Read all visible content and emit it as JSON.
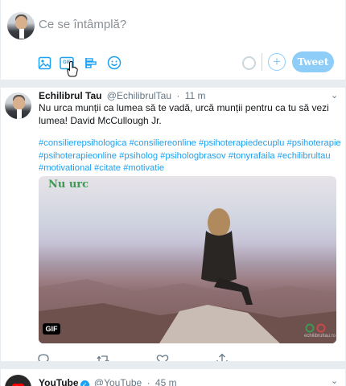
{
  "composer": {
    "placeholder": "Ce se întâmplă?",
    "gif_label": "GIF",
    "tweet_label": "Tweet",
    "add_label": "+",
    "icons": [
      "image-icon",
      "gif-icon",
      "poll-icon",
      "emoji-icon"
    ]
  },
  "tweet1": {
    "name": "Echilibrul Tau",
    "handle": "@EchilibrulTau",
    "separator": "·",
    "time": "11 m",
    "text": "Nu urca munții ca lumea să te vadă, urcă munții pentru ca tu să vezi lumea! David McCullough Jr.",
    "hashtags": "#consilierepsihologica #consiliereonline #psihoterapiedecuplu #psihoterapie #psihoterapieonline #psiholog #psihologbrasov #tonyrafaila #echilibrultau #motivational #citate #motivatie",
    "media": {
      "caption": "Nu urc",
      "badge": "GIF",
      "watermark": "echilibrultau.ro"
    },
    "actions": [
      "reply-icon",
      "retweet-icon",
      "like-icon",
      "share-icon"
    ]
  },
  "tweet2": {
    "name": "YouTube",
    "handle": "@YouTube",
    "separator": "·",
    "time": "45 m"
  },
  "colors": {
    "accent": "#1da1f2",
    "tweet_button": "#8ecdf8",
    "divider": "#e6ecf0",
    "caption_green": "#3d9a55"
  }
}
